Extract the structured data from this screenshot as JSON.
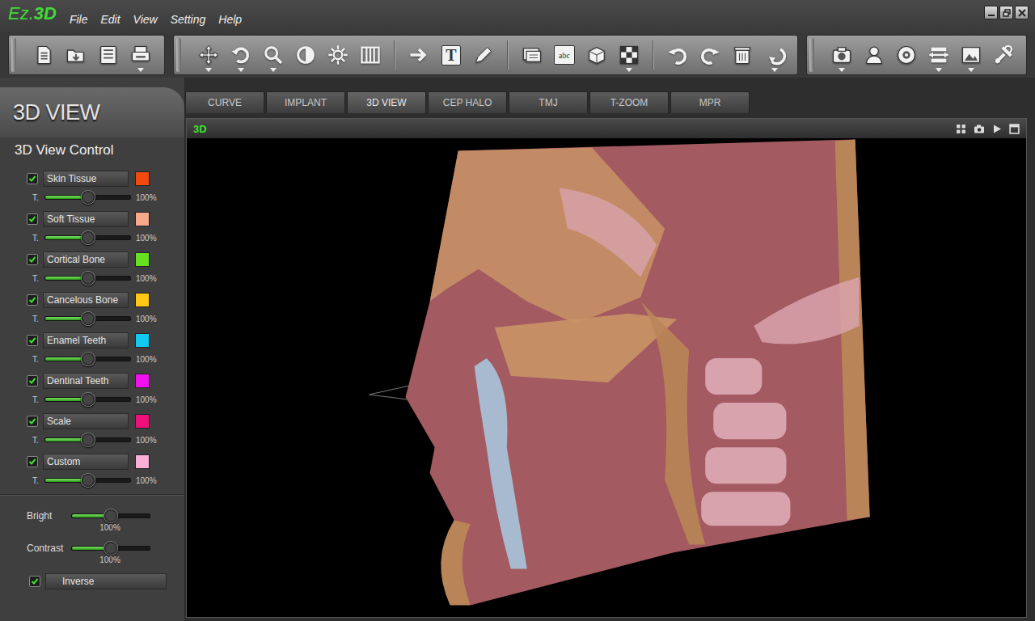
{
  "app": {
    "logo_prefix": "Ez.",
    "logo_main": "3D"
  },
  "menu": [
    "File",
    "Edit",
    "View",
    "Setting",
    "Help"
  ],
  "toolbar": {
    "text_glyph": "T",
    "label_glyph": "abc"
  },
  "section_title": "3D VIEW",
  "tabs": [
    {
      "label": "CURVE",
      "selected": false
    },
    {
      "label": "IMPLANT",
      "selected": false
    },
    {
      "label": "3D VIEW",
      "selected": true
    },
    {
      "label": "CEP HALO",
      "selected": false
    },
    {
      "label": "TMJ",
      "selected": false
    },
    {
      "label": "T-ZOOM",
      "selected": false
    },
    {
      "label": "MPR",
      "selected": false
    }
  ],
  "panel": {
    "title": "3D View Control",
    "layers": [
      {
        "name": "Skin Tissue",
        "checked": true,
        "color": "#f04a10",
        "t_label": "T.",
        "level": 0.5,
        "reading": "100%"
      },
      {
        "name": "Soft Tissue",
        "checked": true,
        "color": "#f8a98a",
        "t_label": "T.",
        "level": 0.5,
        "reading": "100%"
      },
      {
        "name": "Cortical Bone",
        "checked": true,
        "color": "#66e020",
        "t_label": "T.",
        "level": 0.5,
        "reading": "100%"
      },
      {
        "name": "Cancelous Bone",
        "checked": true,
        "color": "#ffc814",
        "t_label": "T.",
        "level": 0.5,
        "reading": "100%"
      },
      {
        "name": "Enamel Teeth",
        "checked": true,
        "color": "#10c8f0",
        "t_label": "T.",
        "level": 0.5,
        "reading": "100%"
      },
      {
        "name": "Dentinal Teeth",
        "checked": true,
        "color": "#f010f0",
        "t_label": "T.",
        "level": 0.5,
        "reading": "100%"
      },
      {
        "name": "Scale",
        "checked": true,
        "color": "#f0107a",
        "t_label": "T.",
        "level": 0.5,
        "reading": "100%"
      },
      {
        "name": "Custom",
        "checked": true,
        "color": "#f8b0d8",
        "t_label": "T.",
        "level": 0.5,
        "reading": "100%"
      }
    ],
    "adjustments": [
      {
        "name": "Bright",
        "level": 0.5,
        "reading": "100%"
      },
      {
        "name": "Contrast",
        "level": 0.5,
        "reading": "100%"
      }
    ],
    "inverse": {
      "label": "Inverse",
      "checked": true
    }
  },
  "viewport": {
    "title": "3D"
  }
}
